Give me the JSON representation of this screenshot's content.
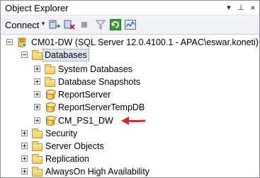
{
  "window": {
    "title": "Object Explorer",
    "dropdown_glyph": "▾",
    "pin_glyph": "⊥",
    "close_glyph": "×"
  },
  "toolbar": {
    "connect_label": "Connect",
    "connect_caret": "▼",
    "icons": [
      "connect-object-explorer-icon",
      "disconnect-icon",
      "stop-icon",
      "filter-icon",
      "refresh-icon",
      "activity-monitor-icon"
    ]
  },
  "tree": {
    "server": "CM01-DW (SQL Server 12.0.4100.1 - APAC\\eswar.koneti)",
    "databases": "Databases",
    "database_children": [
      {
        "label": "System Databases",
        "icon": "folder-icon"
      },
      {
        "label": "Database Snapshots",
        "icon": "folder-icon"
      },
      {
        "label": "ReportServer",
        "icon": "database-icon"
      },
      {
        "label": "ReportServerTempDB",
        "icon": "database-icon"
      },
      {
        "label": "CM_PS1_DW",
        "icon": "database-icon"
      }
    ],
    "top_level": [
      {
        "label": "Security"
      },
      {
        "label": "Server Objects"
      },
      {
        "label": "Replication"
      },
      {
        "label": "AlwaysOn High Availability"
      }
    ]
  },
  "colors": {
    "annotation_arrow": "#e0262d",
    "toolbar_bg": "#eef1f6",
    "selection_bg": "#dfe6f3"
  }
}
